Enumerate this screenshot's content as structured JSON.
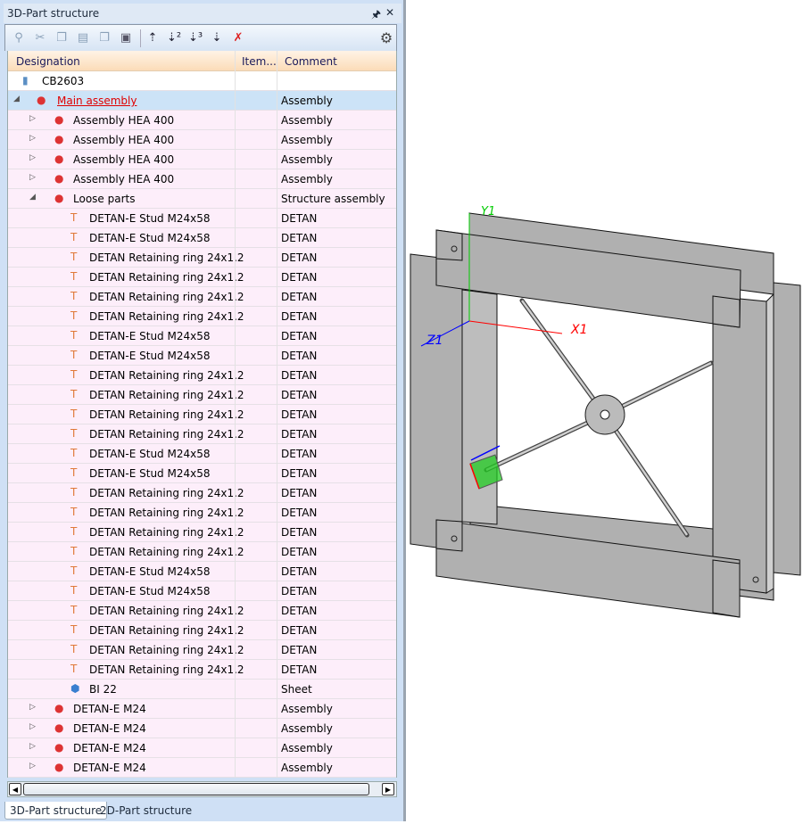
{
  "panel": {
    "title": "3D-Part structure",
    "pin_icon": "pin-icon",
    "close_icon": "close-icon"
  },
  "toolbar": [
    "search-icon",
    "cut-icon",
    "copy-icon",
    "paste-icon",
    "copy-special-icon",
    "paste-special-icon",
    "collapse-level-1-icon",
    "expand-level-2-icon",
    "expand-level-3-icon",
    "expand-all-icon",
    "clear-sort-icon",
    "settings-icon"
  ],
  "columns": {
    "designation": "Designation",
    "item": "Item...",
    "comment": "Comment"
  },
  "rows": [
    {
      "level": 0,
      "exp": "",
      "icon": "model",
      "label": "CB2603",
      "comment": ""
    },
    {
      "level": 0,
      "exp": "open",
      "icon": "assembly",
      "label": "Main assembly",
      "comment": "Assembly",
      "selected": true
    },
    {
      "level": 1,
      "exp": "closed",
      "icon": "assembly",
      "label": "Assembly HEA 400",
      "comment": "Assembly"
    },
    {
      "level": 1,
      "exp": "closed",
      "icon": "assembly",
      "label": "Assembly HEA 400",
      "comment": "Assembly"
    },
    {
      "level": 1,
      "exp": "closed",
      "icon": "assembly",
      "label": "Assembly HEA 400",
      "comment": "Assembly"
    },
    {
      "level": 1,
      "exp": "closed",
      "icon": "assembly",
      "label": "Assembly HEA 400",
      "comment": "Assembly"
    },
    {
      "level": 1,
      "exp": "open",
      "icon": "structure",
      "label": "Loose parts",
      "comment": "Structure assembly"
    },
    {
      "level": 2,
      "exp": "",
      "icon": "part",
      "label": "DETAN-E Stud M24x58",
      "comment": "DETAN"
    },
    {
      "level": 2,
      "exp": "",
      "icon": "part",
      "label": "DETAN-E Stud M24x58",
      "comment": "DETAN"
    },
    {
      "level": 2,
      "exp": "",
      "icon": "part",
      "label": "DETAN Retaining ring 24x1.2",
      "comment": "DETAN"
    },
    {
      "level": 2,
      "exp": "",
      "icon": "part",
      "label": "DETAN Retaining ring 24x1.2",
      "comment": "DETAN"
    },
    {
      "level": 2,
      "exp": "",
      "icon": "part",
      "label": "DETAN Retaining ring 24x1.2",
      "comment": "DETAN"
    },
    {
      "level": 2,
      "exp": "",
      "icon": "part",
      "label": "DETAN Retaining ring 24x1.2",
      "comment": "DETAN"
    },
    {
      "level": 2,
      "exp": "",
      "icon": "part",
      "label": "DETAN-E Stud M24x58",
      "comment": "DETAN"
    },
    {
      "level": 2,
      "exp": "",
      "icon": "part",
      "label": "DETAN-E Stud M24x58",
      "comment": "DETAN"
    },
    {
      "level": 2,
      "exp": "",
      "icon": "part",
      "label": "DETAN Retaining ring 24x1.2",
      "comment": "DETAN"
    },
    {
      "level": 2,
      "exp": "",
      "icon": "part",
      "label": "DETAN Retaining ring 24x1.2",
      "comment": "DETAN"
    },
    {
      "level": 2,
      "exp": "",
      "icon": "part",
      "label": "DETAN Retaining ring 24x1.2",
      "comment": "DETAN"
    },
    {
      "level": 2,
      "exp": "",
      "icon": "part",
      "label": "DETAN Retaining ring 24x1.2",
      "comment": "DETAN"
    },
    {
      "level": 2,
      "exp": "",
      "icon": "part",
      "label": "DETAN-E Stud M24x58",
      "comment": "DETAN"
    },
    {
      "level": 2,
      "exp": "",
      "icon": "part",
      "label": "DETAN-E Stud M24x58",
      "comment": "DETAN"
    },
    {
      "level": 2,
      "exp": "",
      "icon": "part",
      "label": "DETAN Retaining ring 24x1.2",
      "comment": "DETAN"
    },
    {
      "level": 2,
      "exp": "",
      "icon": "part",
      "label": "DETAN Retaining ring 24x1.2",
      "comment": "DETAN"
    },
    {
      "level": 2,
      "exp": "",
      "icon": "part",
      "label": "DETAN Retaining ring 24x1.2",
      "comment": "DETAN"
    },
    {
      "level": 2,
      "exp": "",
      "icon": "part",
      "label": "DETAN Retaining ring 24x1.2",
      "comment": "DETAN"
    },
    {
      "level": 2,
      "exp": "",
      "icon": "part",
      "label": "DETAN-E Stud M24x58",
      "comment": "DETAN"
    },
    {
      "level": 2,
      "exp": "",
      "icon": "part",
      "label": "DETAN-E Stud M24x58",
      "comment": "DETAN"
    },
    {
      "level": 2,
      "exp": "",
      "icon": "part",
      "label": "DETAN Retaining ring 24x1.2",
      "comment": "DETAN"
    },
    {
      "level": 2,
      "exp": "",
      "icon": "part",
      "label": "DETAN Retaining ring 24x1.2",
      "comment": "DETAN"
    },
    {
      "level": 2,
      "exp": "",
      "icon": "part",
      "label": "DETAN Retaining ring 24x1.2",
      "comment": "DETAN"
    },
    {
      "level": 2,
      "exp": "",
      "icon": "part",
      "label": "DETAN Retaining ring 24x1.2",
      "comment": "DETAN"
    },
    {
      "level": 2,
      "exp": "",
      "icon": "sheet",
      "label": "BI 22",
      "comment": "Sheet"
    },
    {
      "level": 1,
      "exp": "closed",
      "icon": "assembly",
      "label": "DETAN-E M24",
      "comment": "Assembly"
    },
    {
      "level": 1,
      "exp": "closed",
      "icon": "assembly",
      "label": "DETAN-E M24",
      "comment": "Assembly"
    },
    {
      "level": 1,
      "exp": "closed",
      "icon": "assembly",
      "label": "DETAN-E M24",
      "comment": "Assembly"
    },
    {
      "level": 1,
      "exp": "closed",
      "icon": "assembly",
      "label": "DETAN-E M24",
      "comment": "Assembly"
    }
  ],
  "tabs": [
    "3D-Part structure",
    "2D-Part structure"
  ],
  "viewport": {
    "axis_x": "X1",
    "axis_y": "Y1",
    "axis_z": "Z1",
    "colors": {
      "x": "#ff0000",
      "y": "#00cc00",
      "z": "#0000ff",
      "steel": "#b0b0b0",
      "selection": "#22cc22"
    }
  }
}
